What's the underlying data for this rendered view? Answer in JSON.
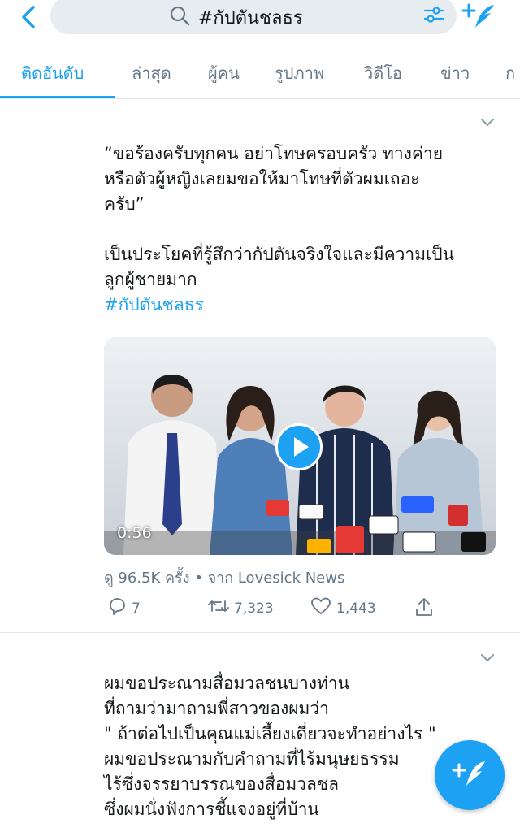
{
  "search": {
    "query": "#กัปตันชลธร"
  },
  "tabs": [
    {
      "label": "ติดอันดับ",
      "active": true
    },
    {
      "label": "ล่าสุด"
    },
    {
      "label": "ผู้คน"
    },
    {
      "label": "รูปภาพ"
    },
    {
      "label": "วิดีโอ"
    },
    {
      "label": "ข่าว"
    },
    {
      "label": "ก"
    }
  ],
  "tweets": [
    {
      "text1": "“ขอร้องครับทุกคน อย่าโทษครอบครัว ทางค่าย\nหรือตัวผู้หญิงเลยมขอให้มาโทษที่ตัวผมเถอะ\nครับ”",
      "text2": "เป็นประโยคที่รู้สึกว่ากัปตันจริงใจและมีความเป็น\nลูกผู้ชายมาก",
      "hashtag": "#กัปตันชลธร",
      "video_duration": "0:56",
      "views": "ดู 96.5K ครั้ง • จาก Lovesick News",
      "replies": "7",
      "retweets": "7,323",
      "likes": "1,443"
    },
    {
      "text": "ผมขอประณามสื่อมวลชนบางท่าน\nที่ถามว่ามาถามพี่สาวของผมว่า\n \" ถ้าต่อไปเป็นคุณแม่เลี้ยงเดี่ยวจะทำอย่างไร \"\nผมขอประณามกับคำถามที่ไร้มนุษยธรรม\nไร้ซึ่งจรรยาบรรณของสื่อมวลชล\nซึ่งผมนั่งฟังการชี้แจงอยู่ที่บ้าน"
    }
  ],
  "colors": {
    "accent": "#1da1f2",
    "text": "#14171a",
    "muted": "#657786",
    "divider": "#e1e8ed"
  }
}
